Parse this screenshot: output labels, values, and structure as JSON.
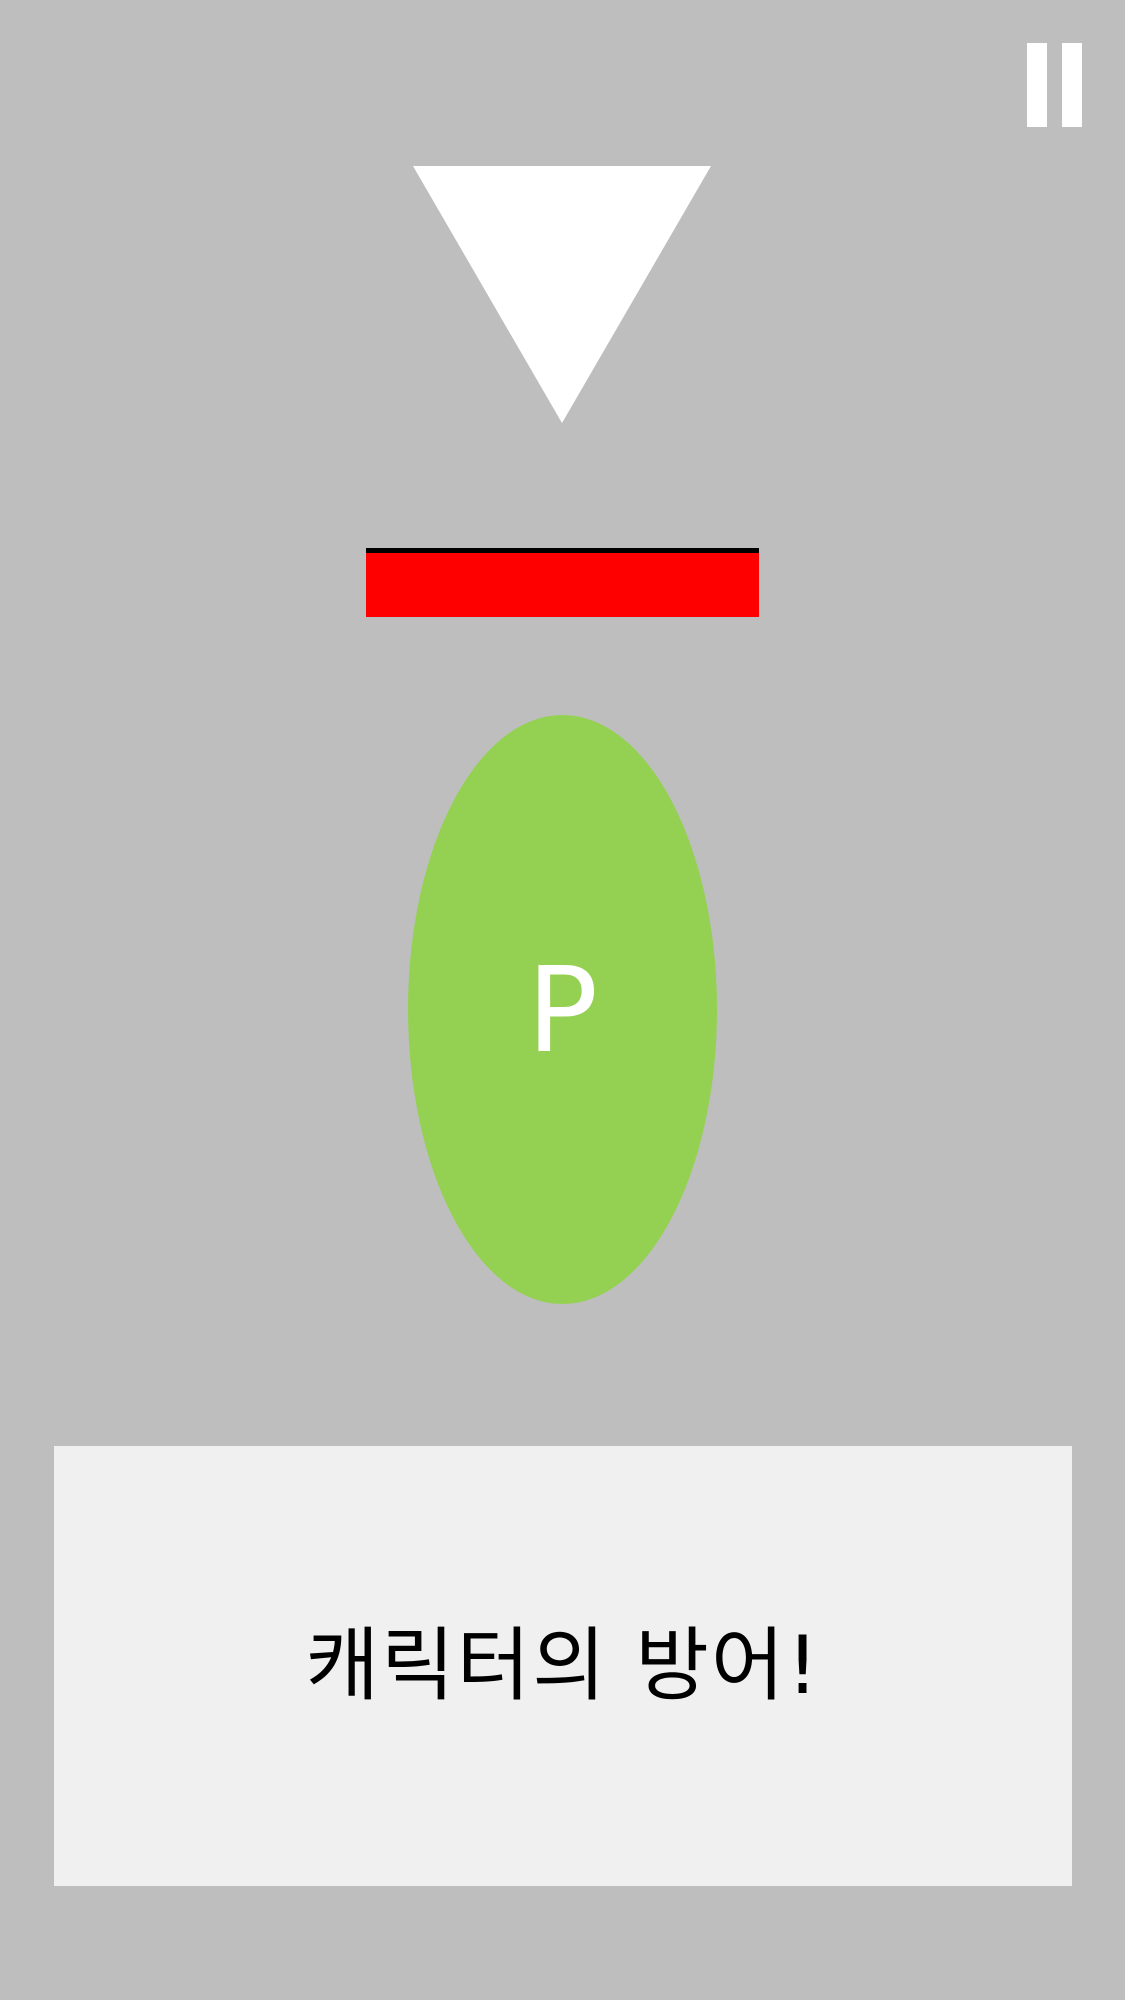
{
  "colors": {
    "background": "#bebebe",
    "pause_icon": "#ffffff",
    "enemy": "#ffffff",
    "shield_fill": "#ff0000",
    "shield_edge": "#000000",
    "player_fill": "#94d152",
    "player_text": "#ffffff",
    "panel_fill": "#f0f0f0",
    "panel_text": "#000000"
  },
  "pause": {
    "icon": "pause-icon"
  },
  "enemy": {
    "shape": "down-triangle"
  },
  "player": {
    "label": "P"
  },
  "message": {
    "text": "캐릭터의 방어!"
  }
}
